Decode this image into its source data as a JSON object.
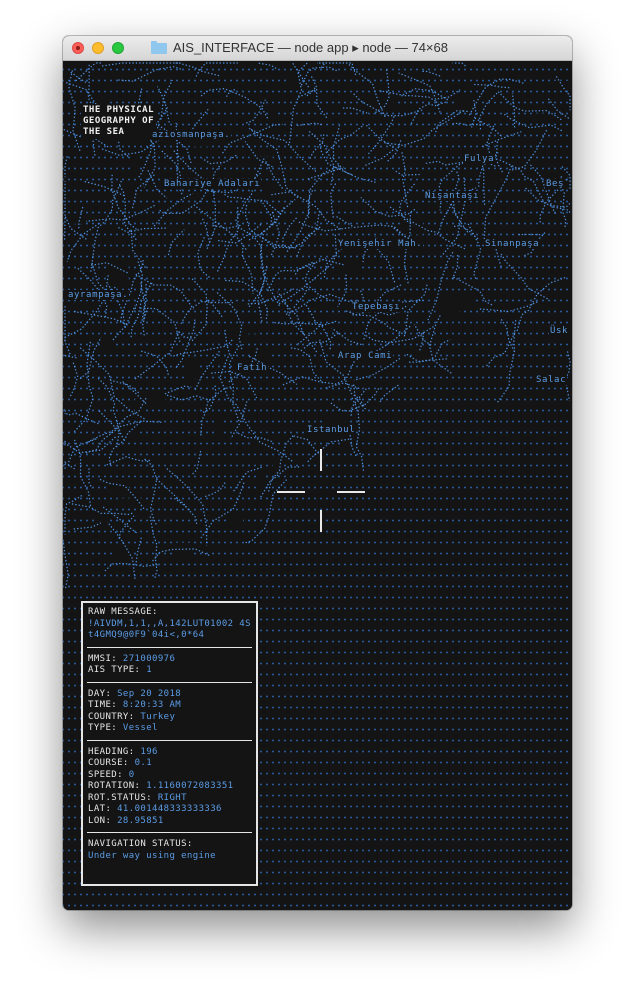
{
  "window": {
    "title": "AIS_INTERFACE — node app ▸ node — 74×68"
  },
  "brand": {
    "title": "THE PHYSICAL\nGEOGRAPHY OF\nTHE SEA"
  },
  "map_labels": [
    "aziosmanpaşa.",
    "Fulya",
    "Bahariye Adaları",
    "Beş",
    "Nişantaşı",
    "Yenişehir Mah.",
    "Sinanpaşa",
    "ayrampaşa.",
    "Tepebaşı",
    "Üsk",
    "Arap Cami",
    "Fatih",
    "Salac",
    "Istanbul"
  ],
  "panel": {
    "raw_label": "RAW MESSAGE:",
    "raw_value": "!AIVDM,1,1,,A,142LUT01002 4St4GMQ9@0F9`04i<,0*64",
    "mmsi_label": "MMSI:",
    "mmsi_value": "271000976",
    "ais_type_label": "AIS TYPE:",
    "ais_type_value": "1",
    "day_label": "DAY:",
    "day_value": "Sep 20 2018",
    "time_label": "TIME:",
    "time_value": "8:20:33 AM",
    "country_label": "COUNTRY:",
    "country_value": "Turkey",
    "type_label": "TYPE:",
    "type_value": "Vessel",
    "heading_label": "HEADING:",
    "heading_value": "196",
    "course_label": "COURSE:",
    "course_value": "0.1",
    "speed_label": "SPEED:",
    "speed_value": "0",
    "rotation_label": "ROTATION:",
    "rotation_value": "1.1160072083351",
    "rot_status_label": "ROT.STATUS:",
    "rot_status_value": "RIGHT",
    "lat_label": "LAT:",
    "lat_value": "41.001448333333336",
    "lon_label": "LON:",
    "lon_value": "28.95851",
    "nav_status_label": "NAVIGATION STATUS:",
    "nav_status_value": "Under way using engine"
  },
  "colors": {
    "terminal_bg": "#141414",
    "accent_blue": "#5b9ce6",
    "text_white": "#e6e6e6"
  }
}
